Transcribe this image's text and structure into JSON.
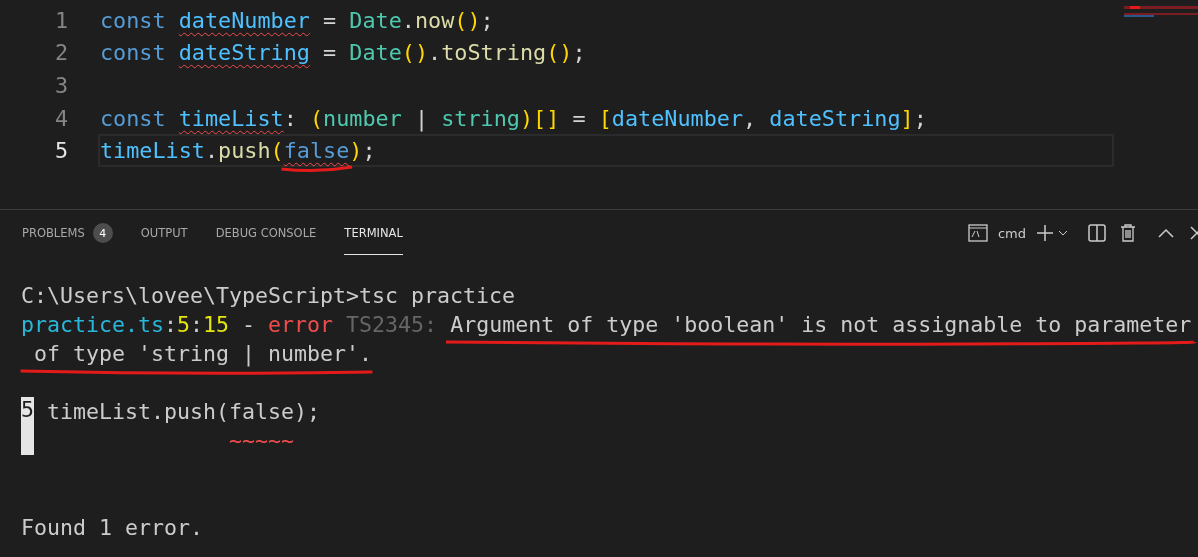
{
  "editor": {
    "lines": [
      {
        "number": "1",
        "current": false,
        "tokens": [
          {
            "kind": "keyword",
            "text": "const "
          },
          {
            "kind": "variable",
            "text": "dateNumber",
            "error": true
          },
          {
            "kind": "plain",
            "text": " = "
          },
          {
            "kind": "type",
            "text": "Date"
          },
          {
            "kind": "plain",
            "text": "."
          },
          {
            "kind": "function",
            "text": "now"
          },
          {
            "kind": "bracket",
            "text": "()"
          },
          {
            "kind": "plain",
            "text": ";"
          }
        ]
      },
      {
        "number": "2",
        "current": false,
        "tokens": [
          {
            "kind": "keyword",
            "text": "const "
          },
          {
            "kind": "variable",
            "text": "dateString",
            "error": true
          },
          {
            "kind": "plain",
            "text": " = "
          },
          {
            "kind": "type",
            "text": "Date"
          },
          {
            "kind": "bracket",
            "text": "()"
          },
          {
            "kind": "plain",
            "text": "."
          },
          {
            "kind": "function",
            "text": "toString"
          },
          {
            "kind": "bracket",
            "text": "()"
          },
          {
            "kind": "plain",
            "text": ";"
          }
        ]
      },
      {
        "number": "3",
        "current": false
      },
      {
        "number": "4",
        "current": false,
        "tokens": [
          {
            "kind": "keyword",
            "text": "const "
          },
          {
            "kind": "variable",
            "text": "timeList",
            "error": true
          },
          {
            "kind": "plain",
            "text": ": "
          },
          {
            "kind": "bracket",
            "text": "("
          },
          {
            "kind": "type",
            "text": "number"
          },
          {
            "kind": "plain",
            "text": " | "
          },
          {
            "kind": "type",
            "text": "string"
          },
          {
            "kind": "bracket",
            "text": ")[]"
          },
          {
            "kind": "plain",
            "text": " = "
          },
          {
            "kind": "bracket",
            "text": "["
          },
          {
            "kind": "variable",
            "text": "dateNumber"
          },
          {
            "kind": "plain",
            "text": ", "
          },
          {
            "kind": "variable",
            "text": "dateString"
          },
          {
            "kind": "bracket",
            "text": "]"
          },
          {
            "kind": "plain",
            "text": ";"
          }
        ]
      },
      {
        "number": "5",
        "current": true,
        "tokens": [
          {
            "kind": "variable",
            "text": "timeList"
          },
          {
            "kind": "plain",
            "text": "."
          },
          {
            "kind": "function",
            "text": "push"
          },
          {
            "kind": "bracket",
            "text": "("
          },
          {
            "kind": "keyword",
            "text": "false",
            "error": true,
            "marked": true
          },
          {
            "kind": "bracket",
            "text": ")"
          },
          {
            "kind": "plain",
            "text": ";"
          }
        ]
      }
    ]
  },
  "panel": {
    "tabs": [
      {
        "label": "PROBLEMS",
        "badge": "4",
        "selected": false
      },
      {
        "label": "OUTPUT",
        "selected": false
      },
      {
        "label": "DEBUG CONSOLE",
        "selected": false
      },
      {
        "label": "TERMINAL",
        "selected": true
      }
    ],
    "terminal_name": "cmd",
    "terminal": {
      "prompt": "C:\\Users\\lovee\\TypeScript>tsc practice",
      "diagnostic": [
        {
          "kind": "file",
          "text": "practice.ts"
        },
        {
          "kind": "punct",
          "text": ":"
        },
        {
          "kind": "num",
          "text": "5"
        },
        {
          "kind": "punct",
          "text": ":"
        },
        {
          "kind": "num",
          "text": "15"
        },
        {
          "kind": "punct",
          "text": " - "
        },
        {
          "kind": "error",
          "text": "error "
        },
        {
          "kind": "code",
          "text": "TS2345: "
        },
        {
          "kind": "message",
          "text": "Argument of type 'boolean' is not assignable to parameter",
          "marked": true
        }
      ],
      "continuation": {
        "text": " of type 'string | number'.",
        "marked": true
      },
      "source_line_number": "5",
      "source_line": "timeList.push(false);",
      "squiggle": "~~~~~",
      "summary": "Found 1 error."
    }
  }
}
